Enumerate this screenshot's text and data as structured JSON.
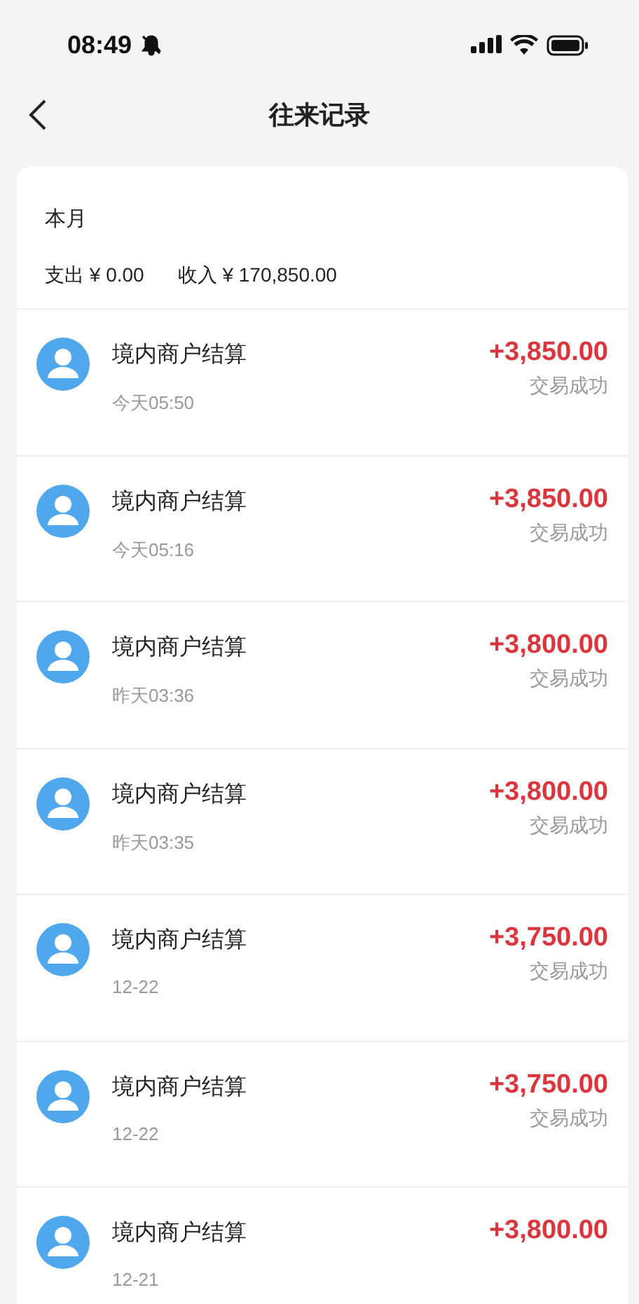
{
  "status_bar": {
    "time": "08:49"
  },
  "header": {
    "title": "往来记录"
  },
  "summary": {
    "period": "本月",
    "expense": "支出 ¥ 0.00",
    "income": "收入 ¥ 170,850.00"
  },
  "records": [
    {
      "title": "境内商户结算",
      "time": "今天05:50",
      "amount": "+3,850.00",
      "status": "交易成功"
    },
    {
      "title": "境内商户结算",
      "time": "今天05:16",
      "amount": "+3,850.00",
      "status": "交易成功"
    },
    {
      "title": "境内商户结算",
      "time": "昨天03:36",
      "amount": "+3,800.00",
      "status": "交易成功"
    },
    {
      "title": "境内商户结算",
      "time": "昨天03:35",
      "amount": "+3,800.00",
      "status": "交易成功"
    },
    {
      "title": "境内商户结算",
      "time": "12-22",
      "amount": "+3,750.00",
      "status": "交易成功"
    },
    {
      "title": "境内商户结算",
      "time": "12-22",
      "amount": "+3,750.00",
      "status": "交易成功"
    },
    {
      "title": "境内商户结算",
      "time": "12-21",
      "amount": "+3,800.00"
    }
  ]
}
